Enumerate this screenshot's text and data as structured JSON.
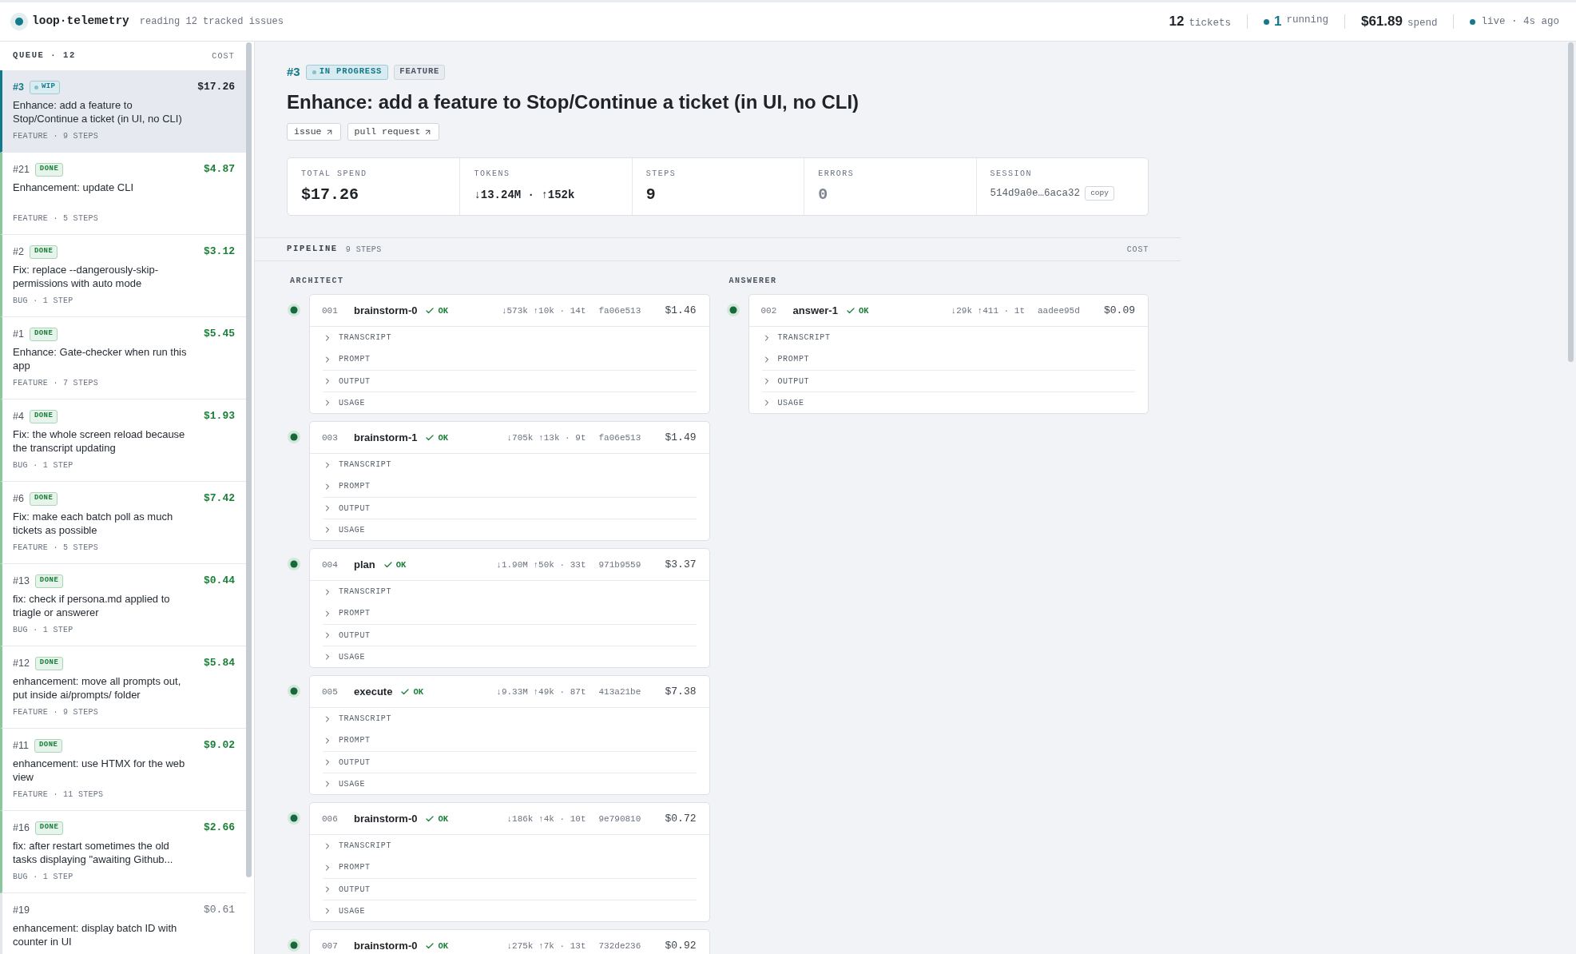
{
  "header": {
    "brand": "loop·telemetry",
    "subtitle": "reading 12 tracked issues",
    "stats": [
      {
        "kind": "total",
        "value": "12",
        "label": "tickets"
      },
      {
        "kind": "running",
        "value": "1",
        "label": "running"
      },
      {
        "kind": "total",
        "value": "$61.89",
        "label": "spend"
      },
      {
        "kind": "live",
        "label": "live · 4s ago"
      }
    ]
  },
  "queue": {
    "title": "QUEUE · 12",
    "cost_heading": "COST",
    "items": [
      {
        "number": "#3",
        "badge": "WIP",
        "kind": "wip",
        "selected": true,
        "title": "Enhance: add a feature to Stop/Continue a ticket (in UI, no CLI)",
        "meta": "FEATURE · 9 STEPS",
        "cost": "$17.26"
      },
      {
        "number": "#21",
        "badge": "DONE",
        "kind": "done",
        "selected": false,
        "title": "Enhancement: update CLI",
        "meta": "FEATURE · 5 STEPS",
        "cost": "$4.87"
      },
      {
        "number": "#2",
        "badge": "DONE",
        "kind": "done",
        "selected": false,
        "title": "Fix: replace --dangerously-skip-permissions with auto mode",
        "meta": "BUG · 1 STEP",
        "cost": "$3.12"
      },
      {
        "number": "#1",
        "badge": "DONE",
        "kind": "done",
        "selected": false,
        "title": "Enhance: Gate-checker when run this app",
        "meta": "FEATURE · 7 STEPS",
        "cost": "$5.45"
      },
      {
        "number": "#4",
        "badge": "DONE",
        "kind": "done",
        "selected": false,
        "title": "Fix: the whole screen reload because the transcript updating",
        "meta": "BUG · 1 STEP",
        "cost": "$1.93"
      },
      {
        "number": "#6",
        "badge": "DONE",
        "kind": "done",
        "selected": false,
        "title": "Fix: make each batch poll as much tickets as possible",
        "meta": "FEATURE · 5 STEPS",
        "cost": "$7.42"
      },
      {
        "number": "#13",
        "badge": "DONE",
        "kind": "done",
        "selected": false,
        "title": "fix: check if persona.md applied to triagle or answerer",
        "meta": "BUG · 1 STEP",
        "cost": "$0.44"
      },
      {
        "number": "#12",
        "badge": "DONE",
        "kind": "done",
        "selected": false,
        "title": "enhancement: move all prompts out, put inside ai/prompts/ folder",
        "meta": "FEATURE · 9 STEPS",
        "cost": "$5.84"
      },
      {
        "number": "#11",
        "badge": "DONE",
        "kind": "done",
        "selected": false,
        "title": "enhancement: use HTMX for the web view",
        "meta": "FEATURE · 11 STEPS",
        "cost": "$9.02"
      },
      {
        "number": "#16",
        "badge": "DONE",
        "kind": "done",
        "selected": false,
        "title": "fix: after restart sometimes the old tasks displaying \"awaiting Github...",
        "meta": "BUG · 1 STEP",
        "cost": "$2.66"
      },
      {
        "number": "#19",
        "kind": "queued",
        "selected": false,
        "title": "enhancement: display batch ID with counter in UI",
        "cost": "$0.61"
      }
    ]
  },
  "ticket": {
    "number": "#3",
    "status": {
      "label": "IN PROGRESS",
      "kind": "in_progress"
    },
    "type_label": "FEATURE",
    "title": "Enhance: add a feature to Stop/Continue a ticket (in UI, no CLI)",
    "links": [
      "issue",
      "pull request"
    ],
    "stats": [
      {
        "kind": "figure",
        "label": "TOTAL SPEND",
        "value": "$17.26"
      },
      {
        "kind": "tokens",
        "label": "TOKENS",
        "value": "↓13.24M · ↑152k"
      },
      {
        "kind": "figure",
        "label": "STEPS",
        "value": "9"
      },
      {
        "kind": "muted",
        "label": "ERRORS",
        "value": "0"
      },
      {
        "kind": "session",
        "label": "SESSION",
        "value": "514d9a0e…6aca32",
        "action": "copy"
      }
    ]
  },
  "pipeline": {
    "title": "PIPELINE",
    "count": "9 STEPS",
    "cost_heading": "COST",
    "lanes": [
      {
        "name": "ARCHITECT",
        "steps": [
          {
            "number": "001",
            "name": "brainstorm-0",
            "kind": "ok",
            "status_label": "OK",
            "tokens": "↓573k ↑10k · 14t",
            "commit": "fa06e513",
            "cost": "$1.46",
            "sections": [
              {
                "label": "TRANSCRIPT",
                "expanded": false
              },
              {
                "label": "PROMPT",
                "expanded": false
              },
              {
                "label": "OUTPUT",
                "expanded": false
              },
              {
                "label": "USAGE",
                "expanded": false
              }
            ]
          },
          {
            "number": "003",
            "name": "brainstorm-1",
            "kind": "ok",
            "status_label": "OK",
            "tokens": "↓705k ↑13k · 9t",
            "commit": "fa06e513",
            "cost": "$1.49",
            "sections": [
              {
                "label": "TRANSCRIPT",
                "expanded": false
              },
              {
                "label": "PROMPT",
                "expanded": false
              },
              {
                "label": "OUTPUT",
                "expanded": false
              },
              {
                "label": "USAGE",
                "expanded": false
              }
            ]
          },
          {
            "number": "004",
            "name": "plan",
            "kind": "ok",
            "status_label": "OK",
            "tokens": "↓1.90M ↑50k · 33t",
            "commit": "971b9559",
            "cost": "$3.37",
            "sections": [
              {
                "label": "TRANSCRIPT",
                "expanded": false
              },
              {
                "label": "PROMPT",
                "expanded": false
              },
              {
                "label": "OUTPUT",
                "expanded": false
              },
              {
                "label": "USAGE",
                "expanded": false
              }
            ]
          },
          {
            "number": "005",
            "name": "execute",
            "kind": "ok",
            "status_label": "OK",
            "tokens": "↓9.33M ↑49k · 87t",
            "commit": "413a21be",
            "cost": "$7.38",
            "sections": [
              {
                "label": "TRANSCRIPT",
                "expanded": false
              },
              {
                "label": "PROMPT",
                "expanded": false
              },
              {
                "label": "OUTPUT",
                "expanded": false
              },
              {
                "label": "USAGE",
                "expanded": false
              }
            ]
          },
          {
            "number": "006",
            "name": "brainstorm-0",
            "kind": "ok",
            "status_label": "OK",
            "tokens": "↓186k ↑4k · 10t",
            "commit": "9e790810",
            "cost": "$0.72",
            "sections": [
              {
                "label": "TRANSCRIPT",
                "expanded": false
              },
              {
                "label": "PROMPT",
                "expanded": false
              },
              {
                "label": "OUTPUT",
                "expanded": false
              },
              {
                "label": "USAGE",
                "expanded": false
              }
            ]
          },
          {
            "number": "007",
            "name": "brainstorm-0",
            "kind": "ok",
            "status_label": "OK",
            "tokens": "↓275k ↑7k · 13t",
            "commit": "732de236",
            "cost": "$0.92"
          }
        ]
      },
      {
        "name": "ANSWERER",
        "steps": [
          {
            "number": "002",
            "name": "answer-1",
            "kind": "ok",
            "status_label": "OK",
            "tokens": "↓29k ↑411 · 1t",
            "commit": "aadee95d",
            "cost": "$0.09",
            "sections": [
              {
                "label": "TRANSCRIPT",
                "expanded": false
              },
              {
                "label": "PROMPT",
                "expanded": false
              },
              {
                "label": "OUTPUT",
                "expanded": false
              },
              {
                "label": "USAGE",
                "expanded": false
              }
            ]
          }
        ]
      }
    ]
  }
}
